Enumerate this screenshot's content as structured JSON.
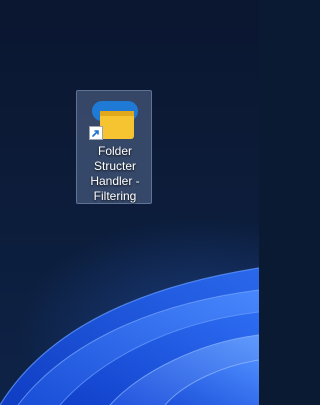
{
  "desktop": {
    "icons": [
      {
        "label_lines": [
          "Folder",
          "Structer",
          "Handler -",
          "Filtering"
        ],
        "icon": "yellow-note-app-icon",
        "has_shortcut_arrow": true,
        "shortcut_icon": "shortcut-arrow-icon",
        "selected": true
      }
    ]
  },
  "colors": {
    "wallpaper_dark": "#0b1a33",
    "bloom_blue": "#1f56e0",
    "icon_yellow": "#f6c431",
    "icon_blue": "#1e7ad4"
  }
}
